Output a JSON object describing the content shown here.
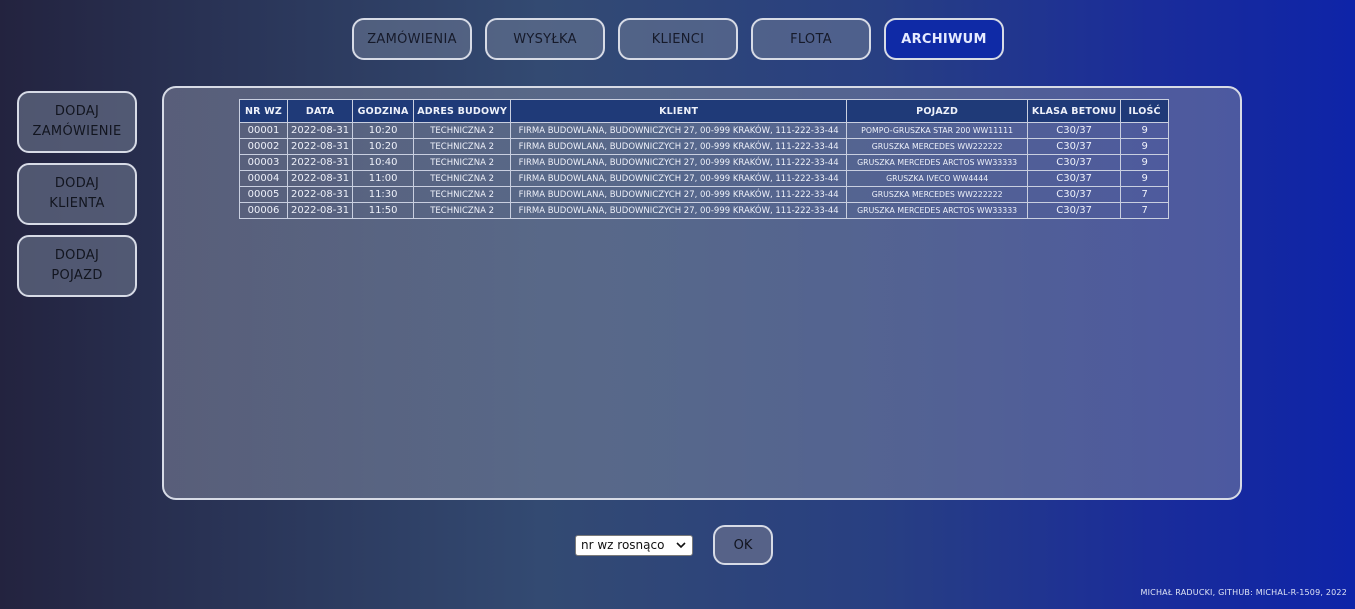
{
  "nav": {
    "items": [
      {
        "label": "ZAMÓWIENIA"
      },
      {
        "label": "WYSYŁKA"
      },
      {
        "label": "KLIENCI"
      },
      {
        "label": "FLOTA"
      },
      {
        "label": "ARCHIWUM"
      }
    ],
    "active": "ARCHIWUM"
  },
  "sidebar": {
    "items": [
      {
        "line1": "DODAJ",
        "line2": "ZAMÓWIENIE"
      },
      {
        "line1": "DODAJ",
        "line2": "KLIENTA"
      },
      {
        "line1": "DODAJ",
        "line2": "POJAZD"
      }
    ]
  },
  "table": {
    "headers": [
      "NR WZ",
      "DATA",
      "GODZINA",
      "ADRES BUDOWY",
      "KLIENT",
      "POJAZD",
      "KLASA BETONU",
      "ILOŚĆ"
    ],
    "rows": [
      [
        "00001",
        "2022-08-31",
        "10:20",
        "TECHNICZNA 2",
        "FIRMA BUDOWLANA, BUDOWNICZYCH 27, 00-999 KRAKÓW, 111-222-33-44",
        "POMPO-GRUSZKA STAR 200 WW11111",
        "C30/37",
        "9"
      ],
      [
        "00002",
        "2022-08-31",
        "10:20",
        "TECHNICZNA 2",
        "FIRMA BUDOWLANA, BUDOWNICZYCH 27, 00-999 KRAKÓW, 111-222-33-44",
        "GRUSZKA MERCEDES WW222222",
        "C30/37",
        "9"
      ],
      [
        "00003",
        "2022-08-31",
        "10:40",
        "TECHNICZNA 2",
        "FIRMA BUDOWLANA, BUDOWNICZYCH 27, 00-999 KRAKÓW, 111-222-33-44",
        "GRUSZKA MERCEDES ARCTOS WW33333",
        "C30/37",
        "9"
      ],
      [
        "00004",
        "2022-08-31",
        "11:00",
        "TECHNICZNA 2",
        "FIRMA BUDOWLANA, BUDOWNICZYCH 27, 00-999 KRAKÓW, 111-222-33-44",
        "GRUSZKA IVECO WW4444",
        "C30/37",
        "9"
      ],
      [
        "00005",
        "2022-08-31",
        "11:30",
        "TECHNICZNA 2",
        "FIRMA BUDOWLANA, BUDOWNICZYCH 27, 00-999 KRAKÓW, 111-222-33-44",
        "GRUSZKA MERCEDES WW222222",
        "C30/37",
        "7"
      ],
      [
        "00006",
        "2022-08-31",
        "11:50",
        "TECHNICZNA 2",
        "FIRMA BUDOWLANA, BUDOWNICZYCH 27, 00-999 KRAKÓW, 111-222-33-44",
        "GRUSZKA MERCEDES ARCTOS WW33333",
        "C30/37",
        "7"
      ]
    ]
  },
  "sort": {
    "selected": "nr wz rosnąco",
    "ok_label": "OK"
  },
  "footer": {
    "text": "MICHAŁ RADUCKI, GITHUB: MICHAL-R-1509, 2022"
  },
  "colors": {
    "active_nav": "#0f2aa6",
    "header_bg": "#1f3a78"
  },
  "icons": {
    "select_arrow": "chevron-down-icon"
  }
}
